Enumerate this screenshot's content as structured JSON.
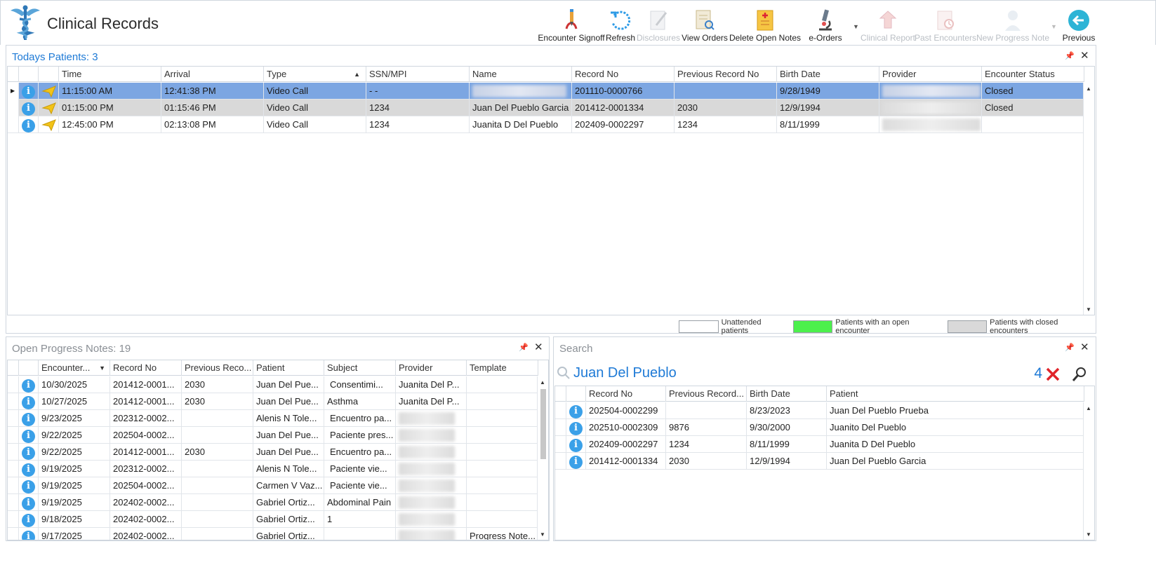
{
  "app": {
    "title": "Clinical Records"
  },
  "toolbar": {
    "encounter_signoff": "Encounter Signoff",
    "refresh": "Refresh",
    "disclosures": "Disclosures",
    "view_orders": "View Orders",
    "delete_open_notes": "Delete Open Notes",
    "e_orders": "e-Orders",
    "clinical_report": "Clinical Report",
    "past_encounters": "Past Encounters",
    "new_progress_note": "New Progress Note",
    "previous": "Previous"
  },
  "today": {
    "title_label": "Todays Patients:",
    "count": "3",
    "columns": [
      "Time",
      "Arrival",
      "Type",
      "SSN/MPI",
      "Name",
      "Record No",
      "Previous Record No",
      "Birth Date",
      "Provider",
      "Encounter Status"
    ],
    "rows": [
      {
        "time": "11:15:00 AM",
        "arrival": "12:41:38 PM",
        "type": "Video Call",
        "ssn": "-  -",
        "name": "",
        "record": "201110-0000766",
        "prev": "",
        "birth": "9/28/1949",
        "provider": "",
        "status": "Closed"
      },
      {
        "time": "01:15:00 PM",
        "arrival": "01:15:46 PM",
        "type": "Video Call",
        "ssn": "1234",
        "name": "Juan Del Pueblo Garcia",
        "record": "201412-0001334",
        "prev": "2030",
        "birth": "12/9/1994",
        "provider": "",
        "status": "Closed"
      },
      {
        "time": "12:45:00 PM",
        "arrival": "02:13:08 PM",
        "type": "Video Call",
        "ssn": "1234",
        "name": "Juanita D Del Pueblo",
        "record": "202409-0002297",
        "prev": "1234",
        "birth": "8/11/1999",
        "provider": "",
        "status": ""
      }
    ],
    "legend": {
      "unattended": "Unattended patients",
      "open": "Patients with an open encounter",
      "closed": "Patients with closed encounters",
      "open_color": "#4cf04c",
      "closed_color": "#d9d9d9"
    }
  },
  "notes": {
    "title_label": "Open Progress Notes:",
    "count": "19",
    "columns": [
      "Encounter...",
      "Record No",
      "Previous Reco...",
      "Patient",
      "Subject",
      "Provider",
      "Template"
    ],
    "rows": [
      {
        "date": "10/30/2025",
        "record": "201412-0001...",
        "prev": "2030",
        "patient": "Juan Del Pue...",
        "subject": "Consentimi...",
        "provider": "Juanita Del P...",
        "template": ""
      },
      {
        "date": "10/27/2025",
        "record": "201412-0001...",
        "prev": "2030",
        "patient": "Juan Del Pue...",
        "subject": "Asthma",
        "provider": "Juanita Del P...",
        "template": ""
      },
      {
        "date": "9/23/2025",
        "record": "202312-0002...",
        "prev": "",
        "patient": "Alenis N Tole...",
        "subject": "Encuentro pa...",
        "provider": "",
        "template": ""
      },
      {
        "date": "9/22/2025",
        "record": "202504-0002...",
        "prev": "",
        "patient": "Juan Del Pue...",
        "subject": "Paciente pres...",
        "provider": "",
        "template": ""
      },
      {
        "date": "9/22/2025",
        "record": "201412-0001...",
        "prev": "2030",
        "patient": "Juan Del Pue...",
        "subject": "Encuentro pa...",
        "provider": "",
        "template": ""
      },
      {
        "date": "9/19/2025",
        "record": "202312-0002...",
        "prev": "",
        "patient": "Alenis N Tole...",
        "subject": "Paciente vie...",
        "provider": "",
        "template": ""
      },
      {
        "date": "9/19/2025",
        "record": "202504-0002...",
        "prev": "",
        "patient": "Carmen V Vaz...",
        "subject": "Paciente vie...",
        "provider": "",
        "template": ""
      },
      {
        "date": "9/19/2025",
        "record": "202402-0002...",
        "prev": "",
        "patient": "Gabriel Ortiz...",
        "subject": "Abdominal Pain",
        "provider": "",
        "template": ""
      },
      {
        "date": "9/18/2025",
        "record": "202402-0002...",
        "prev": "",
        "patient": "Gabriel Ortiz...",
        "subject": "1",
        "provider": "",
        "template": ""
      },
      {
        "date": "9/17/2025",
        "record": "202402-0002...",
        "prev": "",
        "patient": "Gabriel Ortiz...",
        "subject": "",
        "provider": "",
        "template": "Progress Note..."
      }
    ]
  },
  "search": {
    "title": "Search",
    "query": "Juan Del Pueblo",
    "count": "4",
    "columns": [
      "Record No",
      "Previous Record...",
      "Birth Date",
      "Patient"
    ],
    "rows": [
      {
        "record": "202504-0002299",
        "prev": "",
        "birth": "8/23/2023",
        "patient": "Juan Del Pueblo Prueba"
      },
      {
        "record": "202510-0002309",
        "prev": "9876",
        "birth": "9/30/2000",
        "patient": "Juanito Del Pueblo"
      },
      {
        "record": "202409-0002297",
        "prev": "1234",
        "birth": "8/11/1999",
        "patient": "Juanita D Del Pueblo"
      },
      {
        "record": "201412-0001334",
        "prev": "2030",
        "birth": "12/9/1994",
        "patient": "Juan Del Pueblo Garcia"
      }
    ]
  },
  "icons": {
    "logo": "caduceus-logo",
    "info": "i"
  }
}
